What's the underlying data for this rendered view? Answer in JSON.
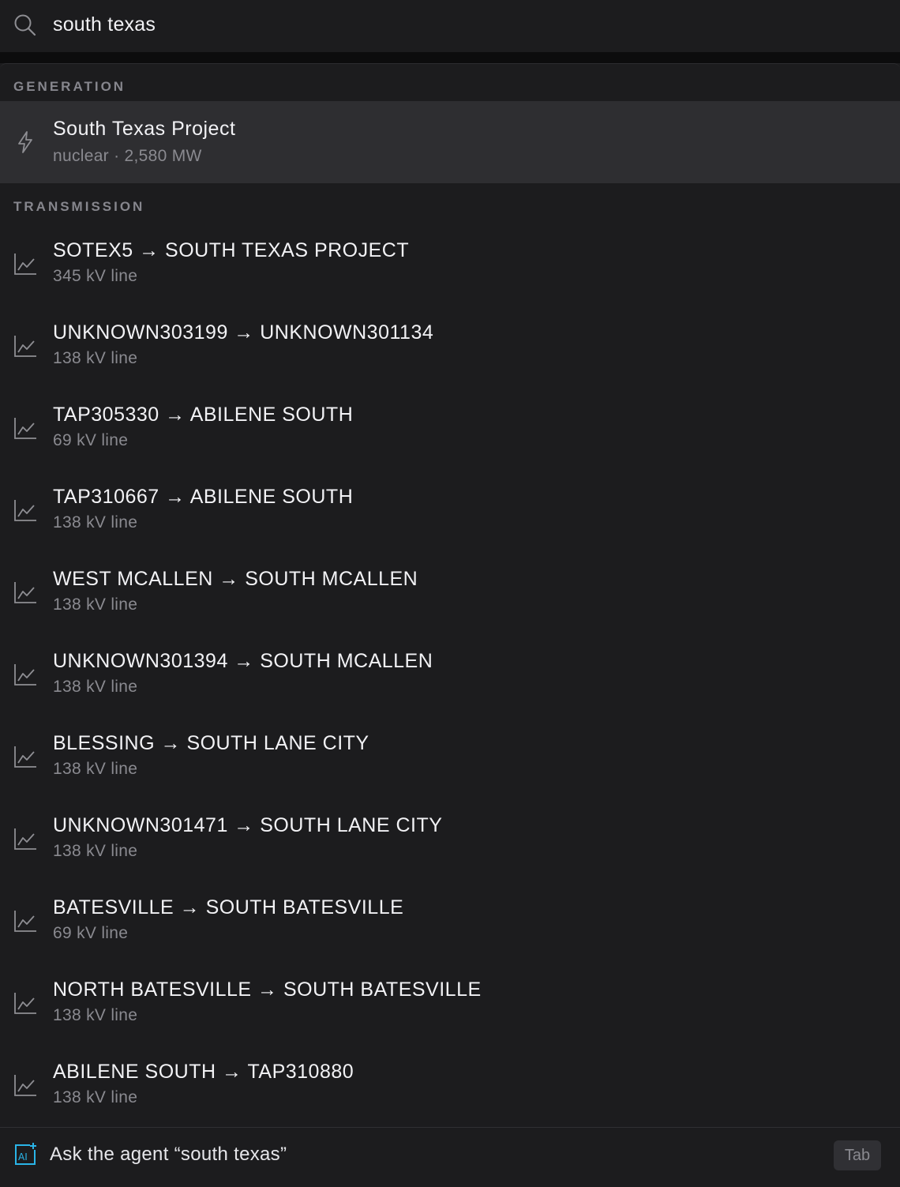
{
  "search": {
    "query": "south texas"
  },
  "generation": {
    "header": "GENERATION",
    "items": [
      {
        "title": "South Texas Project",
        "subtitle": "nuclear · 2,580 MW",
        "icon": "lightning-bolt-icon"
      }
    ]
  },
  "transmission": {
    "header": "TRANSMISSION",
    "items": [
      {
        "title": "SOTEX5 → SOUTH TEXAS PROJECT",
        "subtitle": "345 kV line",
        "icon": "line-chart-icon"
      },
      {
        "title": "UNKNOWN303199 → UNKNOWN301134",
        "subtitle": "138 kV line",
        "icon": "line-chart-icon"
      },
      {
        "title": "TAP305330 → ABILENE SOUTH",
        "subtitle": "69 kV line",
        "icon": "line-chart-icon"
      },
      {
        "title": "TAP310667 → ABILENE SOUTH",
        "subtitle": "138 kV line",
        "icon": "line-chart-icon"
      },
      {
        "title": "WEST MCALLEN → SOUTH MCALLEN",
        "subtitle": "138 kV line",
        "icon": "line-chart-icon"
      },
      {
        "title": "UNKNOWN301394 → SOUTH MCALLEN",
        "subtitle": "138 kV line",
        "icon": "line-chart-icon"
      },
      {
        "title": "BLESSING → SOUTH LANE CITY",
        "subtitle": "138 kV line",
        "icon": "line-chart-icon"
      },
      {
        "title": "UNKNOWN301471 → SOUTH LANE CITY",
        "subtitle": "138 kV line",
        "icon": "line-chart-icon"
      },
      {
        "title": "BATESVILLE → SOUTH BATESVILLE",
        "subtitle": "69 kV line",
        "icon": "line-chart-icon"
      },
      {
        "title": "NORTH BATESVILLE → SOUTH BATESVILLE",
        "subtitle": "138 kV line",
        "icon": "line-chart-icon"
      },
      {
        "title": "ABILENE SOUTH → TAP310880",
        "subtitle": "138 kV line",
        "icon": "line-chart-icon"
      }
    ]
  },
  "footer": {
    "ask_label": "Ask the agent “south texas”",
    "tab_key": "Tab",
    "ai_badge": "AI"
  },
  "colors": {
    "background": "#1c1c1e",
    "selected_row": "#2e2e31",
    "ai_accent": "#2ab4e8"
  }
}
